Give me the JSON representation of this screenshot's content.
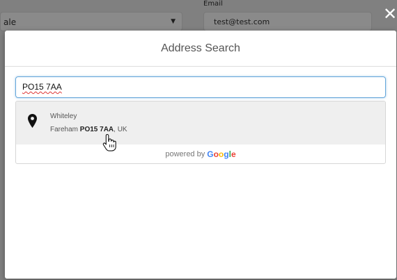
{
  "background": {
    "email_label": "Email",
    "select_text": "ale",
    "email_value": "test@test.com"
  },
  "modal": {
    "title": "Address Search",
    "close_glyph": "✕",
    "search": {
      "value": "PO15 7AA"
    },
    "results": [
      {
        "line1": "Whiteley",
        "line2_prefix": "Fareham ",
        "line2_bold": "PO15 7AA",
        "line2_suffix": ", UK"
      }
    ],
    "powered_by": "powered by",
    "google_letters": [
      "G",
      "o",
      "o",
      "g",
      "l",
      "e"
    ]
  },
  "colors": {
    "accent": "#64a6da"
  }
}
